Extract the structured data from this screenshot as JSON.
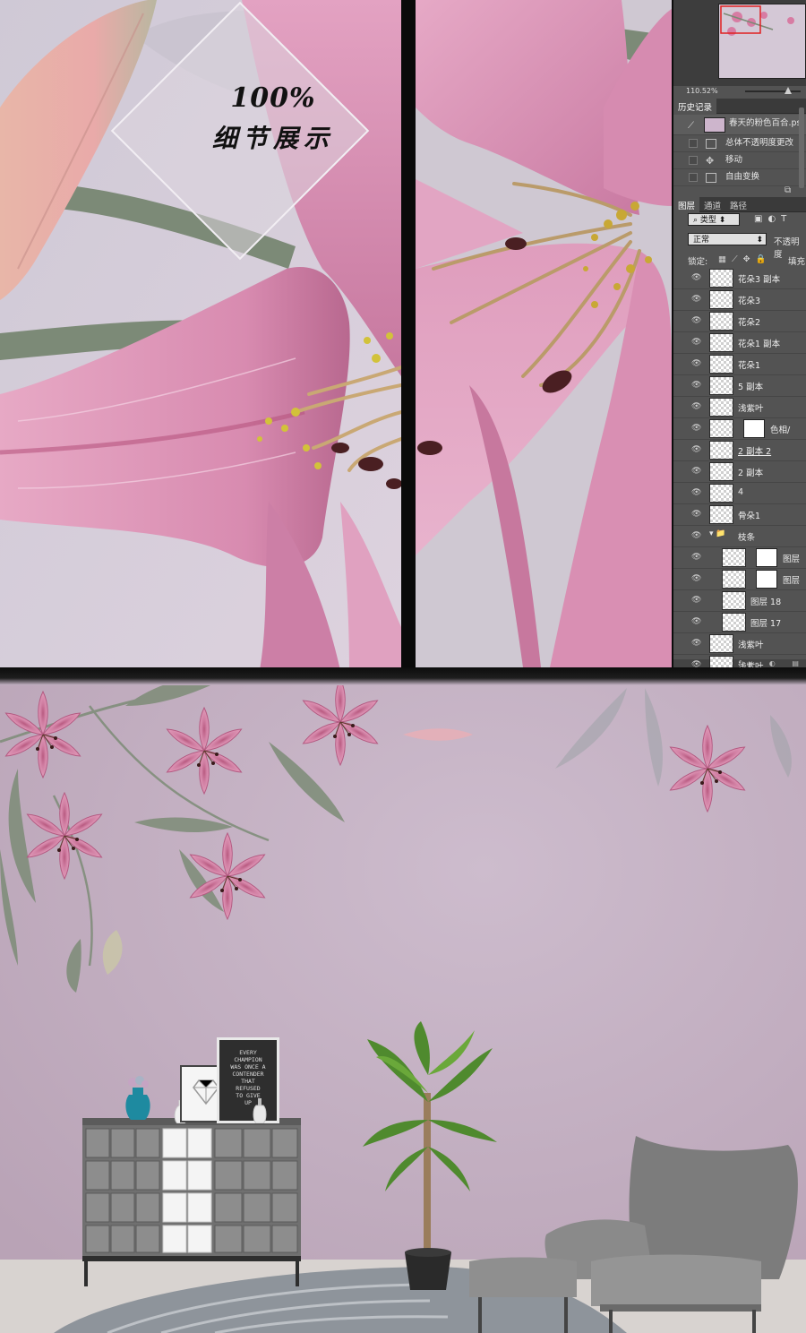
{
  "detail_badge": {
    "line1": "100%",
    "line2": "细节展示"
  },
  "photoshop": {
    "zoom": "110.52%",
    "history_tab": "历史记录",
    "history": [
      {
        "label": "春天的粉色百合.ps"
      },
      {
        "label": "总体不透明度更改"
      },
      {
        "label": "移动"
      },
      {
        "label": "自由变换"
      }
    ],
    "layers_tabs": [
      "图层",
      "通道",
      "路径"
    ],
    "filter_label": "类型",
    "blend_mode": "正常",
    "opacity_label": "不透明度",
    "lock_label": "锁定:",
    "fill_label": "填充",
    "layers": [
      {
        "name": "花朵3 副本"
      },
      {
        "name": "花朵3"
      },
      {
        "name": "花朵2"
      },
      {
        "name": "花朵1 副本"
      },
      {
        "name": "花朵1"
      },
      {
        "name": "5 副本"
      },
      {
        "name": "浅紫叶"
      },
      {
        "name": "色相/"
      },
      {
        "name": "2 副本 2"
      },
      {
        "name": "2 副本"
      },
      {
        "name": "4"
      },
      {
        "name": "骨朵1"
      },
      {
        "name": "枝条"
      },
      {
        "name": "图层"
      },
      {
        "name": "图层"
      },
      {
        "name": "图层 18"
      },
      {
        "name": "图层 17"
      },
      {
        "name": "浅紫叶"
      },
      {
        "name": "浅紫叶"
      }
    ]
  },
  "poster": {
    "lines": [
      "EVERY",
      "CHAMPION",
      "WAS ONCE A",
      "CONTENDER",
      "THAT",
      "REFUSED",
      "TO GIVE",
      "UP"
    ]
  },
  "colors": {
    "petal": "#d98fae",
    "petal_dark": "#b05a7e",
    "stem": "#7d8a78",
    "wall": "#c9b7c9",
    "ps_panel": "#535353"
  }
}
